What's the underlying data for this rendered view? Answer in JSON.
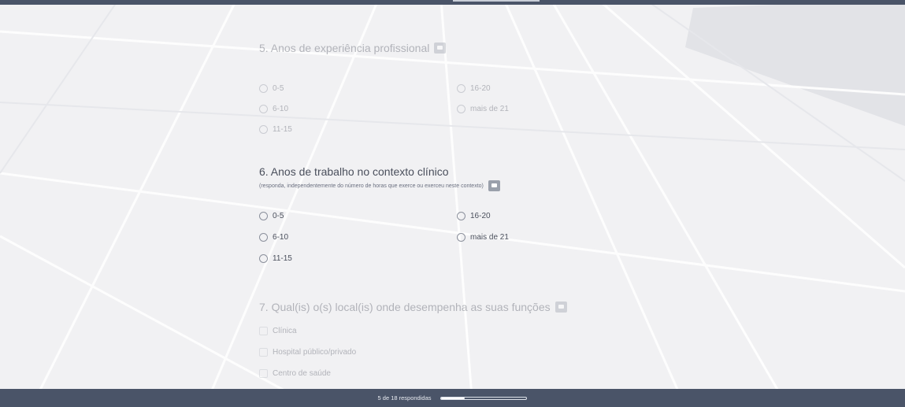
{
  "progress": {
    "text": "5 de 18 respondidas",
    "answered": 5,
    "total": 18
  },
  "questions": {
    "q5": {
      "title": "5. Anos de experiência profissional",
      "icon": "comment-icon",
      "options": [
        "0-5",
        "6-10",
        "11-15",
        "16-20",
        "mais de 21"
      ]
    },
    "q6": {
      "title": "6. Anos de trabalho no contexto clínico",
      "hint": "(responda, independentemente do número de horas que exerce ou exerceu neste contexto)",
      "icon": "comment-icon",
      "options": [
        "0-5",
        "6-10",
        "11-15",
        "16-20",
        "mais de 21"
      ]
    },
    "q7": {
      "title": "7. Qual(is) o(s) local(is) onde desempenha as suas funções",
      "icon": "comment-icon",
      "options": [
        "Clínica",
        "Hospital público/privado",
        "Centro de saúde"
      ]
    }
  },
  "colors": {
    "bar": "#4a5468",
    "background": "#f1f1f3",
    "text": "#4a4f5c"
  }
}
